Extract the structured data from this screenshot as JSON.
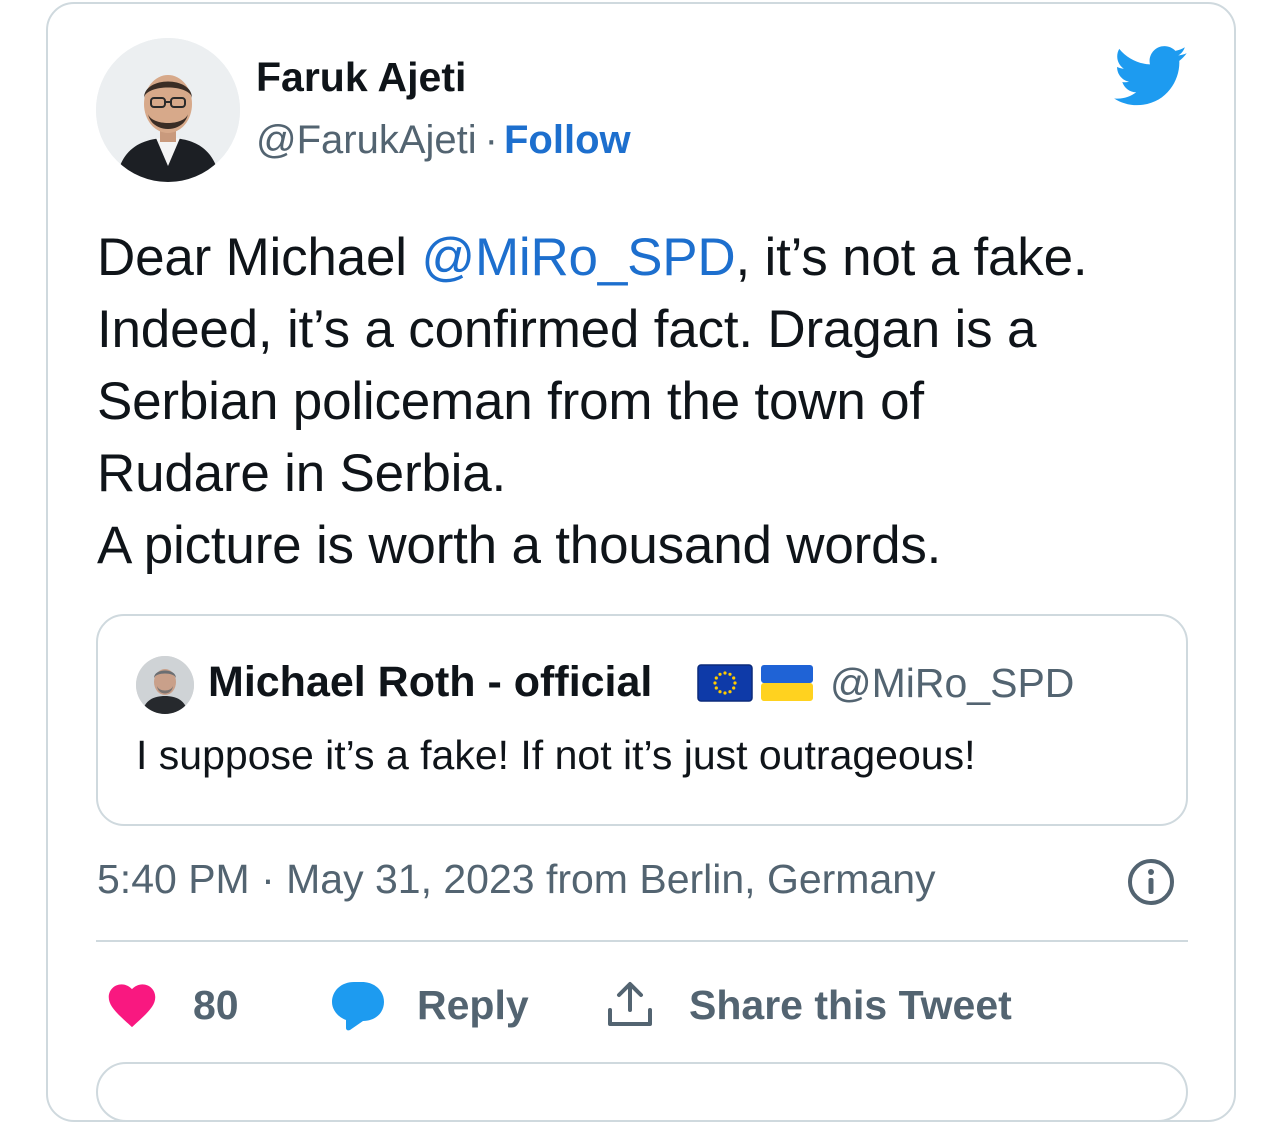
{
  "author": {
    "display_name": "Faruk Ajeti",
    "handle": "@FarukAjeti",
    "separator": "·",
    "follow_label": "Follow"
  },
  "tweet": {
    "line1_prefix": "Dear Michael ",
    "line1_mention": "@MiRo_SPD",
    "line1_suffix": ", it’s not a fake.",
    "line2": "Indeed, it’s a confirmed fact. Dragan is a",
    "line3": "Serbian policeman from the town of",
    "line4": "Rudare in Serbia.",
    "line5": "A picture is worth a thousand words."
  },
  "quoted_tweet": {
    "display_name": "Michael Roth - official",
    "handle": "@MiRo_SPD",
    "text": "I suppose it’s a fake! If not it’s just outrageous!"
  },
  "meta": {
    "timestamp": "5:40 PM · May 31, 2023 from Berlin, Germany"
  },
  "actions": {
    "like_count": "80",
    "reply_label": "Reply",
    "share_label": "Share this Tweet"
  },
  "colors": {
    "link": "#1d6fce",
    "twitter_blue": "#1d9bf0",
    "heart": "#f91880",
    "muted": "#536471",
    "border": "#cfd9de"
  }
}
